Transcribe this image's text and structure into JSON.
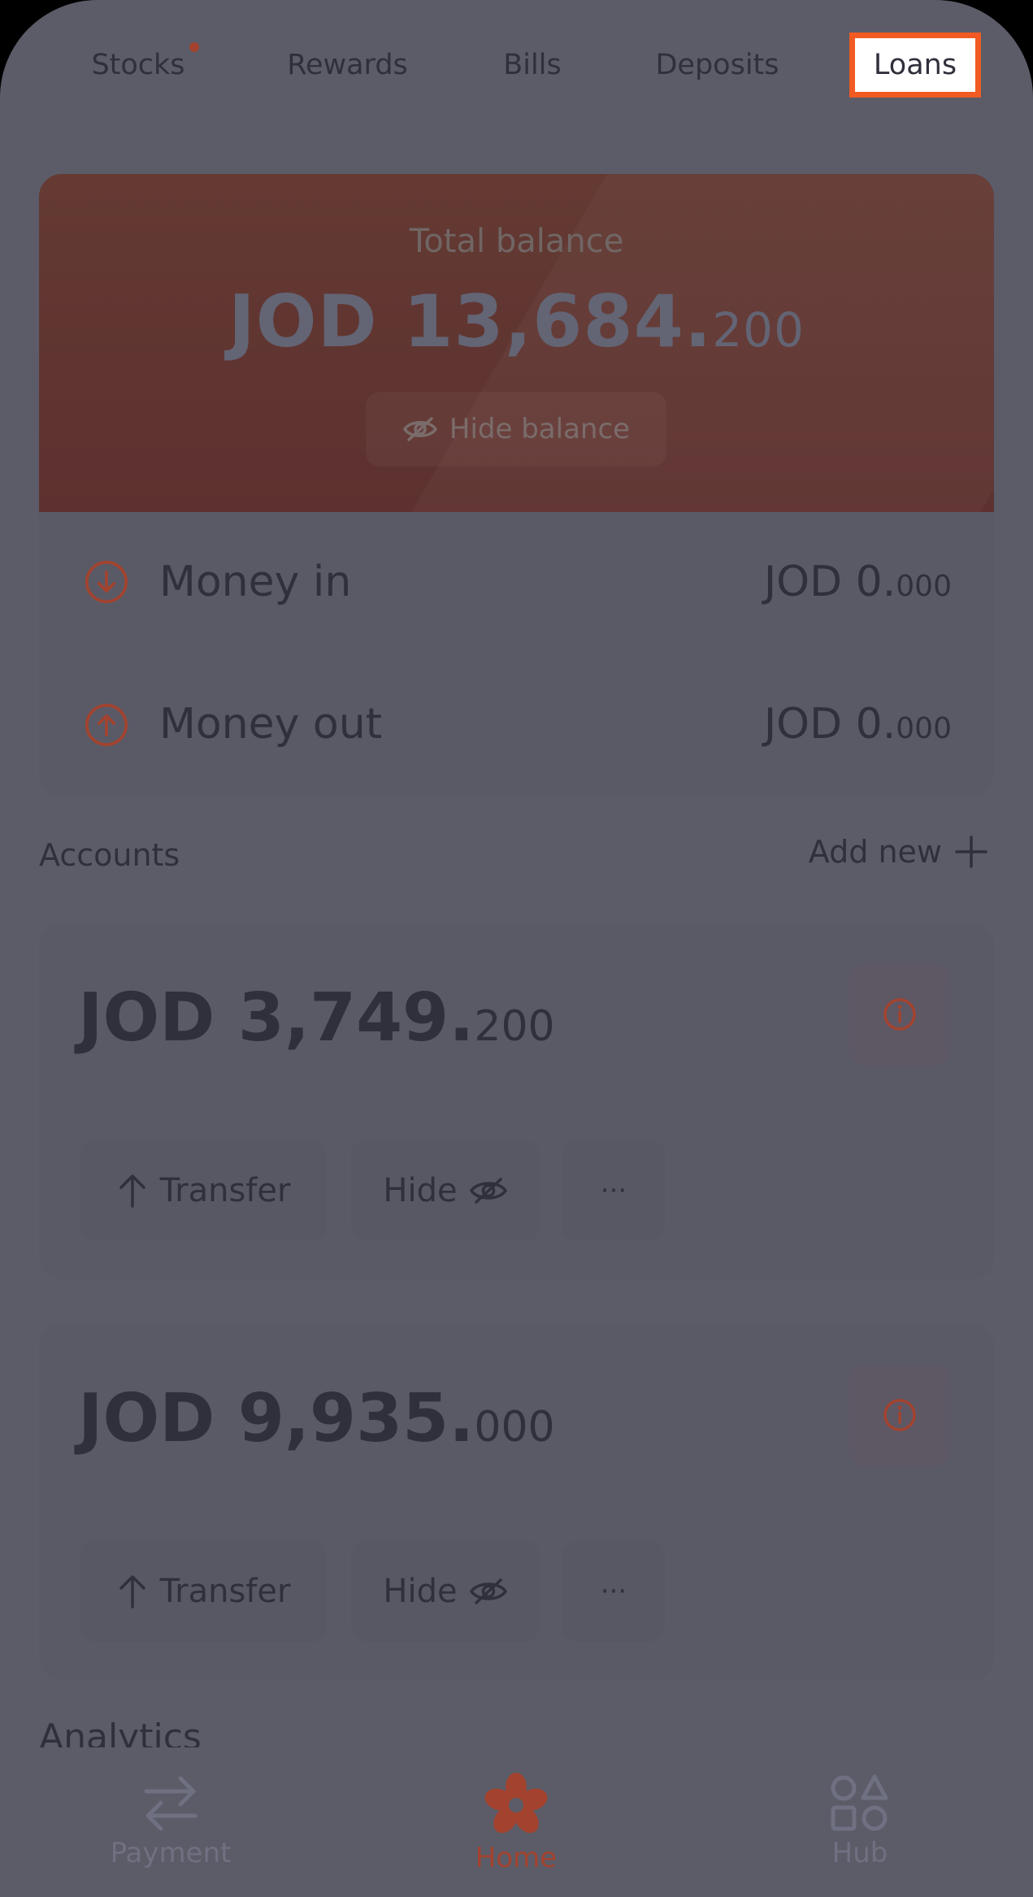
{
  "tabs": [
    {
      "label": "Stocks",
      "has_dot": true
    },
    {
      "label": "Rewards"
    },
    {
      "label": "Bills"
    },
    {
      "label": "Deposits"
    },
    {
      "label": "Loans",
      "highlighted": true
    }
  ],
  "balance": {
    "label": "Total balance",
    "amount_main": "JOD 13,684.",
    "amount_fraction": "200",
    "hide_label": "Hide balance"
  },
  "money": {
    "in": {
      "label": "Money in",
      "value_main": "JOD 0.",
      "value_fraction": "000"
    },
    "out": {
      "label": "Money out",
      "value_main": "JOD 0.",
      "value_fraction": "000"
    }
  },
  "accounts": {
    "title": "Accounts",
    "add_new_label": "Add new",
    "items": [
      {
        "amount_main": "JOD 3,749.",
        "amount_fraction": "200",
        "transfer_label": "Transfer",
        "hide_label": "Hide",
        "more_label": "···"
      },
      {
        "amount_main": "JOD 9,935.",
        "amount_fraction": "000",
        "transfer_label": "Transfer",
        "hide_label": "Hide",
        "more_label": "···"
      }
    ]
  },
  "analytics": {
    "title": "Analytics"
  },
  "bottom_nav": [
    {
      "label": "Payment",
      "icon": "transfer-arrows-icon"
    },
    {
      "label": "Home",
      "icon": "flower-logo-icon",
      "active": true
    },
    {
      "label": "Hub",
      "icon": "shapes-icon"
    }
  ],
  "colors": {
    "accent": "#f15a22",
    "icon_accent": "#a3432f",
    "overlay_bg": "#5b5c68",
    "text_dark": "#2f303b"
  }
}
